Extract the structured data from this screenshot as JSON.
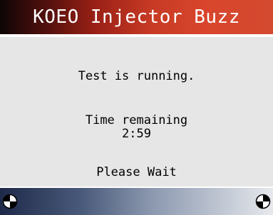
{
  "header": {
    "title": "KOEO Injector Buzz"
  },
  "message": {
    "status": "Test is running.",
    "time_label": "Time remaining",
    "time_value": "2:59",
    "prompt": "Please Wait"
  },
  "footer": {
    "left_icon": "left-scroll-icon",
    "right_icon": "right-scroll-icon"
  }
}
